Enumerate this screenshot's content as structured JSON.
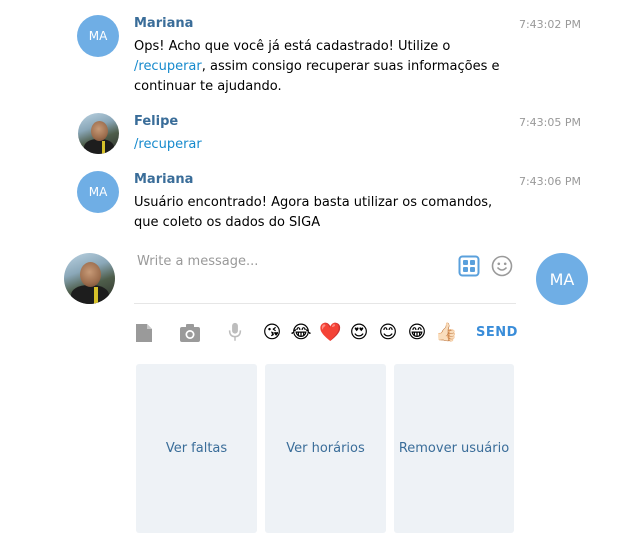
{
  "messages": [
    {
      "avatar_initials": "MA",
      "sender": "Mariana",
      "time": "7:43:02 PM",
      "text_before": "Ops! Acho que você já está cadastrado! Utilize o ",
      "link": "/recuperar",
      "text_after": ", assim consigo recuperar suas informações e continuar te ajudando."
    },
    {
      "sender": "Felipe",
      "time": "7:43:05 PM",
      "link": "/recuperar"
    },
    {
      "avatar_initials": "MA",
      "sender": "Mariana",
      "time": "7:43:06 PM",
      "text": "Usuário encontrado! Agora basta utilizar os comandos, que coleto os dados do SIGA"
    }
  ],
  "composer": {
    "placeholder": "Write a message...",
    "bot_initials": "MA",
    "send_label": "SEND",
    "emojis": [
      "😘",
      "😂",
      "❤️",
      "😍",
      "😊",
      "😁",
      "👍🏻"
    ]
  },
  "keyboard": {
    "buttons": [
      "Ver faltas",
      "Ver horários",
      "Remover usuário"
    ]
  },
  "colors": {
    "accent": "#6faee5",
    "link": "#168acd",
    "name": "#3a6d99",
    "send": "#3a8dd9",
    "button_bg": "#eef2f6"
  }
}
